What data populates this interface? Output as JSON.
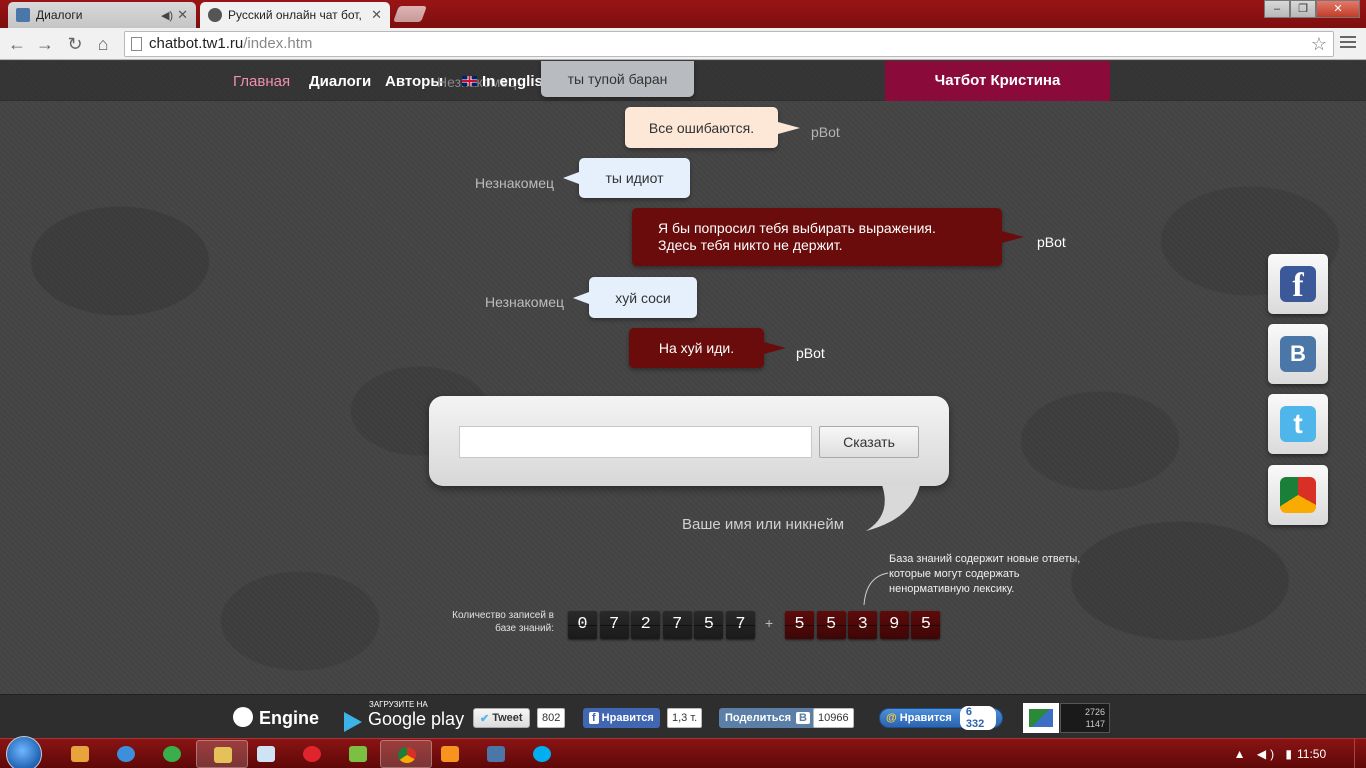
{
  "browser": {
    "tabs": [
      {
        "title": "Диалоги",
        "active": false
      },
      {
        "title": "Русский онлайн чат бот, ",
        "active": true
      }
    ],
    "url_host": "chatbot.tw1.ru",
    "url_path": "/index.htm"
  },
  "nav": {
    "home": "Главная",
    "dialogs": "Диалоги",
    "authors": "Авторы",
    "ghost": "Незнакомец",
    "english": "In english",
    "chatbot": "Чатбот Кристина"
  },
  "chat": [
    {
      "speaker": "",
      "text": "ты тупой баран",
      "style": "gray"
    },
    {
      "speaker": "pBot",
      "text": "Все ошибаются.",
      "style": "botlight"
    },
    {
      "speaker": "Незнакомец",
      "text": "ты идиот",
      "style": "user"
    },
    {
      "speaker": "pBot",
      "text": "Я бы попросил тебя выбирать выражения. Здесь тебя никто не держит.",
      "style": "botdark"
    },
    {
      "speaker": "Незнакомец",
      "text": "хуй соси",
      "style": "user"
    },
    {
      "speaker": "pBot",
      "text": "На хуй иди.",
      "style": "botdark"
    }
  ],
  "input": {
    "value": "",
    "say_button": "Сказать",
    "nick_prompt": "Ваше имя или никнейм"
  },
  "counter": {
    "label": "Количество записей в базе знаний:",
    "main_digits": [
      "0",
      "7",
      "2",
      "7",
      "5",
      "7"
    ],
    "plus": "+",
    "extra_digits": [
      "5",
      "5",
      "3",
      "9",
      "5"
    ],
    "note": "База знаний содержит новые ответы, которые могут содержать ненормативную лексику."
  },
  "side_icons": [
    "facebook-icon",
    "vkontakte-icon",
    "twitter-icon",
    "chrome-store-icon"
  ],
  "footer": {
    "engine": "Engine",
    "gplay_small": "ЗАГРУЗИТЕ НА",
    "gplay_big": "Google play",
    "tweet": "Tweet",
    "tweet_count": "802",
    "fb_like": "Нравится",
    "fb_count": "1,3 т.",
    "vk_share": "Поделиться",
    "vk_share_letter": "B",
    "vk_count": "10966",
    "mail_like": "Нравится",
    "mail_count": "6 332",
    "stat1": "2726",
    "stat2": "1147"
  },
  "taskbar": {
    "time": "11:50"
  },
  "colors": {
    "nav_active": "#f08fb0",
    "chatbot_tab": "#8a0b3a",
    "bot_bubble_dark": "#6a0c0c",
    "digit_red": "#5e0b0b"
  }
}
